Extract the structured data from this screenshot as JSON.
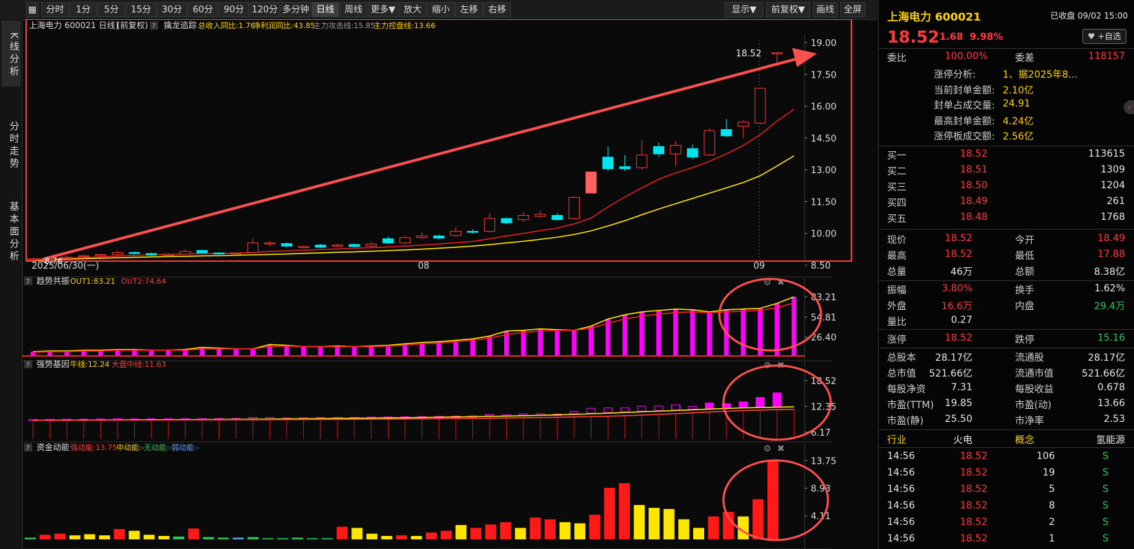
{
  "toolbar": {
    "left": [
      "分时",
      "1分",
      "5分",
      "15分",
      "30分",
      "60分",
      "90分",
      "120分",
      "多分钟",
      "日线",
      "周线",
      "更多▼",
      "放大",
      "缩小",
      "左移",
      "右移"
    ],
    "active": "日线",
    "right": [
      "显示▼",
      "前复权▼",
      "画线",
      "全屏"
    ]
  },
  "side_tabs": [
    "K线分析",
    "分时走势",
    "基本面分析"
  ],
  "kline": {
    "header": {
      "stock": "上海电力 600021 日线]",
      "adjust": "(前复权)",
      "q": "?",
      "indicator": "擒龙追踪",
      "items": [
        {
          "text": "总收入同比:1.76",
          "color": "#ffd400"
        },
        {
          "text": "净利润同比:43.85",
          "color": "#ffd400"
        },
        {
          "text": "主力攻击线:15.85",
          "color": "#9a9a9a"
        },
        {
          "text": "主力控盘线:13.66",
          "color": "#ffd400"
        }
      ]
    },
    "y_ticks": [
      "19.00",
      "17.50",
      "16.00",
      "14.50",
      "13.00",
      "11.50",
      "10.00",
      "8.50"
    ],
    "x_labels": [
      "2025/06/30(一)",
      "08",
      "09"
    ],
    "last_label": "18.52",
    "low_label": "8.76"
  },
  "ind1": {
    "title": "趋势共振",
    "q": "?",
    "items": [
      {
        "text": "OUT1:83.21",
        "color": "#ffd400"
      },
      {
        "text": "OUT2:74.64",
        "color": "#ff3a3a"
      }
    ],
    "y_ticks": [
      "83.21",
      "54.81",
      "26.40"
    ]
  },
  "ind2": {
    "title": "强势基因",
    "q": "?",
    "items": [
      {
        "text": "牛线:12.24",
        "color": "#ffd400"
      },
      {
        "text": "大盘中线:11.63",
        "color": "#ff3a3a"
      }
    ],
    "y_ticks": [
      "18.52",
      "12.35",
      "6.17"
    ]
  },
  "ind3": {
    "title": "资金动能",
    "q": "?",
    "items": [
      {
        "text": "强动能:13.75",
        "color": "#ff3a3a"
      },
      {
        "text": "中动能:-",
        "color": "#ffd400"
      },
      {
        "text": "无动能:-",
        "color": "#2ec55b"
      },
      {
        "text": "弱动能:-",
        "color": "#5aa0ff"
      }
    ],
    "y_ticks": [
      "13.75",
      "8.93",
      "4.11"
    ]
  },
  "chart_data": [
    {
      "type": "candlestick",
      "title": "上海电力 600021 日线",
      "ylim": [
        8.5,
        19.0
      ],
      "x_labels": [
        "2025/06/30(一)",
        "08",
        "09"
      ],
      "candles": [
        {
          "o": 8.76,
          "c": 8.8,
          "h": 8.85,
          "l": 8.7
        },
        {
          "o": 8.78,
          "c": 8.85,
          "h": 8.9,
          "l": 8.75
        },
        {
          "o": 8.85,
          "c": 8.88,
          "h": 8.95,
          "l": 8.8
        },
        {
          "o": 8.9,
          "c": 8.95,
          "h": 9.0,
          "l": 8.85
        },
        {
          "o": 8.95,
          "c": 9.0,
          "h": 9.05,
          "l": 8.9
        },
        {
          "o": 9.0,
          "c": 9.1,
          "h": 9.2,
          "l": 8.95
        },
        {
          "o": 9.1,
          "c": 9.05,
          "h": 9.15,
          "l": 9.0
        },
        {
          "o": 9.05,
          "c": 8.98,
          "h": 9.1,
          "l": 8.95
        },
        {
          "o": 9.0,
          "c": 9.02,
          "h": 9.06,
          "l": 8.96
        },
        {
          "o": 9.02,
          "c": 9.15,
          "h": 9.25,
          "l": 9.0
        },
        {
          "o": 9.2,
          "c": 9.08,
          "h": 9.22,
          "l": 9.05
        },
        {
          "o": 9.08,
          "c": 9.05,
          "h": 9.1,
          "l": 9.0
        },
        {
          "o": 9.05,
          "c": 9.08,
          "h": 9.12,
          "l": 9.02
        },
        {
          "o": 9.1,
          "c": 9.55,
          "h": 9.75,
          "l": 9.08
        },
        {
          "o": 9.5,
          "c": 9.55,
          "h": 9.65,
          "l": 9.4
        },
        {
          "o": 9.52,
          "c": 9.4,
          "h": 9.58,
          "l": 9.35
        },
        {
          "o": 9.35,
          "c": 9.38,
          "h": 9.42,
          "l": 9.3
        },
        {
          "o": 9.45,
          "c": 9.35,
          "h": 9.5,
          "l": 9.3
        },
        {
          "o": 9.4,
          "c": 9.45,
          "h": 9.5,
          "l": 9.35
        },
        {
          "o": 9.48,
          "c": 9.38,
          "h": 9.52,
          "l": 9.35
        },
        {
          "o": 9.4,
          "c": 9.5,
          "h": 9.58,
          "l": 9.36
        },
        {
          "o": 9.75,
          "c": 9.55,
          "h": 9.85,
          "l": 9.5
        },
        {
          "o": 9.55,
          "c": 9.8,
          "h": 9.9,
          "l": 9.5
        },
        {
          "o": 9.8,
          "c": 9.88,
          "h": 10.05,
          "l": 9.75
        },
        {
          "o": 9.88,
          "c": 9.78,
          "h": 9.95,
          "l": 9.72
        },
        {
          "o": 9.9,
          "c": 10.1,
          "h": 10.3,
          "l": 9.85
        },
        {
          "o": 10.1,
          "c": 10.05,
          "h": 10.2,
          "l": 9.98
        },
        {
          "o": 10.1,
          "c": 10.7,
          "h": 10.95,
          "l": 10.05
        },
        {
          "o": 10.7,
          "c": 10.5,
          "h": 10.75,
          "l": 10.45
        },
        {
          "o": 10.65,
          "c": 10.85,
          "h": 11.0,
          "l": 10.55
        },
        {
          "o": 10.8,
          "c": 10.9,
          "h": 11.05,
          "l": 10.75
        },
        {
          "o": 10.85,
          "c": 10.65,
          "h": 10.95,
          "l": 10.6
        },
        {
          "o": 10.7,
          "c": 11.7,
          "h": 11.75,
          "l": 10.65
        },
        {
          "o": 11.9,
          "c": 12.9,
          "h": 12.9,
          "l": 11.9
        },
        {
          "o": 13.6,
          "c": 13.05,
          "h": 14.1,
          "l": 12.95
        },
        {
          "o": 13.15,
          "c": 13.05,
          "h": 13.7,
          "l": 12.95
        },
        {
          "o": 13.1,
          "c": 13.7,
          "h": 14.4,
          "l": 13.0
        },
        {
          "o": 14.1,
          "c": 13.75,
          "h": 14.3,
          "l": 13.6
        },
        {
          "o": 13.75,
          "c": 14.15,
          "h": 14.35,
          "l": 13.2
        },
        {
          "o": 14.0,
          "c": 13.6,
          "h": 14.2,
          "l": 13.5
        },
        {
          "o": 13.7,
          "c": 14.85,
          "h": 14.95,
          "l": 13.65
        },
        {
          "o": 14.9,
          "c": 14.6,
          "h": 15.4,
          "l": 14.55
        },
        {
          "o": 15.05,
          "c": 15.25,
          "h": 15.35,
          "l": 14.5
        },
        {
          "o": 15.2,
          "c": 16.85,
          "h": 16.85,
          "l": 15.15
        },
        {
          "o": 18.49,
          "c": 18.52,
          "h": 18.52,
          "l": 17.88
        }
      ],
      "ma_red": [
        8.78,
        8.8,
        8.83,
        8.86,
        8.89,
        8.93,
        8.96,
        8.99,
        9.01,
        9.03,
        9.05,
        9.06,
        9.07,
        9.1,
        9.15,
        9.18,
        9.21,
        9.24,
        9.27,
        9.3,
        9.33,
        9.36,
        9.4,
        9.45,
        9.5,
        9.56,
        9.62,
        9.75,
        9.88,
        10.0,
        10.13,
        10.25,
        10.45,
        10.72,
        11.25,
        11.72,
        12.15,
        12.55,
        12.85,
        13.1,
        13.4,
        13.75,
        14.15,
        14.65,
        15.3,
        15.85
      ],
      "ma_yellow": [
        8.75,
        8.77,
        8.79,
        8.81,
        8.83,
        8.85,
        8.87,
        8.89,
        8.91,
        8.92,
        8.94,
        8.95,
        8.97,
        8.99,
        9.01,
        9.03,
        9.06,
        9.08,
        9.11,
        9.13,
        9.16,
        9.19,
        9.22,
        9.26,
        9.3,
        9.35,
        9.4,
        9.47,
        9.55,
        9.63,
        9.72,
        9.82,
        9.95,
        10.12,
        10.35,
        10.6,
        10.88,
        11.15,
        11.4,
        11.65,
        11.9,
        12.15,
        12.4,
        12.72,
        13.18,
        13.66
      ]
    },
    {
      "type": "bar",
      "title": "趋势共振",
      "ylim": [
        0,
        90
      ],
      "series": [
        {
          "name": "OUT1",
          "values": [
            6,
            7,
            7,
            8,
            8,
            9,
            9,
            8,
            8,
            9,
            12,
            11,
            10,
            10,
            16,
            15,
            13,
            13,
            14,
            13,
            14,
            15,
            17,
            19,
            20,
            22,
            24,
            28,
            35,
            36,
            38,
            37,
            36,
            42,
            52,
            58,
            62,
            64,
            66,
            65,
            62,
            65,
            66,
            67,
            74,
            83.21
          ]
        },
        {
          "name": "OUT2",
          "values": [
            5,
            6,
            6,
            7,
            7,
            8,
            8,
            8,
            8,
            8,
            10,
            10,
            10,
            10,
            13,
            14,
            13,
            13,
            13,
            13,
            13,
            14,
            15,
            17,
            18,
            20,
            22,
            25,
            30,
            33,
            35,
            36,
            36,
            39,
            46,
            52,
            56,
            59,
            61,
            62,
            61,
            62,
            63,
            64,
            68,
            74.64
          ]
        }
      ]
    },
    {
      "type": "bar",
      "title": "强势基因",
      "ylim": [
        4.5,
        20
      ],
      "series": [
        {
          "name": "牛线",
          "values": [
            9.0,
            9.02,
            9.04,
            9.06,
            9.08,
            9.1,
            9.12,
            9.14,
            9.16,
            9.18,
            9.2,
            9.22,
            9.24,
            9.26,
            9.3,
            9.34,
            9.38,
            9.42,
            9.46,
            9.5,
            9.54,
            9.58,
            9.62,
            9.68,
            9.74,
            9.8,
            9.86,
            9.94,
            10.02,
            10.1,
            10.2,
            10.3,
            10.42,
            10.56,
            10.72,
            10.88,
            11.04,
            11.2,
            11.36,
            11.52,
            11.68,
            11.84,
            11.98,
            12.08,
            12.16,
            12.24
          ]
        },
        {
          "name": "大盘中线",
          "values": [
            9.0,
            9.01,
            9.02,
            9.03,
            9.04,
            9.05,
            9.06,
            9.07,
            9.08,
            9.09,
            9.1,
            9.11,
            9.12,
            9.13,
            9.15,
            9.17,
            9.19,
            9.21,
            9.23,
            9.25,
            9.27,
            9.29,
            9.32,
            9.35,
            9.38,
            9.42,
            9.46,
            9.5,
            9.55,
            9.6,
            9.66,
            9.72,
            9.8,
            9.88,
            9.98,
            10.1,
            10.25,
            10.42,
            10.6,
            10.8,
            11.0,
            11.18,
            11.34,
            11.46,
            11.56,
            11.63
          ]
        }
      ]
    },
    {
      "type": "bar",
      "title": "资金动能",
      "ylim": [
        0,
        14.5
      ],
      "values": [
        0.3,
        0.8,
        1.0,
        0.7,
        0.9,
        0.7,
        1.8,
        1.5,
        0.8,
        0.6,
        0.5,
        1.9,
        0.4,
        0.3,
        0.3,
        0.4,
        0.2,
        0.2,
        0.3,
        0.2,
        0.2,
        2.2,
        2.0,
        1.0,
        0.6,
        0.7,
        0.6,
        1.2,
        1.5,
        2.5,
        2.0,
        2.6,
        3.0,
        2.0,
        3.8,
        3.5,
        3.0,
        2.8,
        4.3,
        9.0,
        9.8,
        6.0,
        5.5,
        5.3,
        3.5,
        2.0,
        4.0,
        4.8,
        4.0,
        7.0,
        13.75
      ],
      "colors": [
        "#2ec55b",
        "#ff1a1a",
        "#ff1a1a",
        "#ffe600",
        "#ffe600",
        "#ffe600",
        "#ff1a1a",
        "#ffe600",
        "#ffe600",
        "#ffe600",
        "#2ec55b",
        "#ff1a1a",
        "#2ec55b",
        "#2ec55b",
        "#5aa0ff",
        "#2ec55b",
        "#2ec55b",
        "#2ec55b",
        "#2ec55b",
        "#2ec55b",
        "#2ec55b",
        "#ff1a1a",
        "#ffe600",
        "#ffe600",
        "#ffe600",
        "#ff1a1a",
        "#ffe600",
        "#ff1a1a",
        "#ff1a1a",
        "#ffe600",
        "#ff1a1a",
        "#ff1a1a",
        "#ff1a1a",
        "#ffe600",
        "#ff1a1a",
        "#ff1a1a",
        "#ffe600",
        "#ffe600",
        "#ff1a1a",
        "#ff1a1a",
        "#ff1a1a",
        "#ffe600",
        "#ffe600",
        "#ffe600",
        "#ffe600",
        "#ffe600",
        "#ff1a1a",
        "#ff1a1a",
        "#ffe600",
        "#ff1a1a",
        "#ff1a1a"
      ]
    }
  ],
  "panel": {
    "name": "上海电力 600021",
    "status": "已收盘 09/02 15:00",
    "price": "18.52",
    "change": "1.68",
    "pct": "9.98%",
    "watch": "+自选",
    "row1": {
      "l1": "委比",
      "v1": "100.00%",
      "l2": "委差",
      "v2": "118157"
    },
    "limit": [
      {
        "k": "涨停分析:",
        "v": "1、据2025年8..."
      },
      {
        "k": "当前封单金额:",
        "v": "2.10亿"
      },
      {
        "k": "封单占成交量:",
        "v": "24.91"
      },
      {
        "k": "最高封单金额:",
        "v": "4.24亿"
      },
      {
        "k": "涨停板成交额:",
        "v": "2.56亿"
      }
    ],
    "bids": [
      {
        "l": "买一",
        "p": "18.52",
        "v": "113615"
      },
      {
        "l": "买二",
        "p": "18.51",
        "v": "1309"
      },
      {
        "l": "买三",
        "p": "18.50",
        "v": "1204"
      },
      {
        "l": "买四",
        "p": "18.49",
        "v": "261"
      },
      {
        "l": "买五",
        "p": "18.48",
        "v": "1768"
      }
    ],
    "quote1": [
      {
        "l1": "现价",
        "v1": "18.52",
        "c1": "red",
        "l2": "今开",
        "v2": "18.49",
        "c2": "red"
      },
      {
        "l1": "最高",
        "v1": "18.52",
        "c1": "red",
        "l2": "最低",
        "v2": "17.88",
        "c2": "red"
      },
      {
        "l1": "总量",
        "v1": "46万",
        "c1": "white",
        "l2": "总额",
        "v2": "8.38亿",
        "c2": "white"
      }
    ],
    "quote2": [
      {
        "l1": "振幅",
        "v1": "3.80%",
        "c1": "red",
        "l2": "换手",
        "v2": "1.62%",
        "c2": "white"
      },
      {
        "l1": "外盘",
        "v1": "16.6万",
        "c1": "red",
        "l2": "内盘",
        "v2": "29.4万",
        "c2": "green"
      },
      {
        "l1": "量比",
        "v1": "0.27",
        "c1": "white",
        "l2": "",
        "v2": "",
        "c2": "white"
      }
    ],
    "limits": {
      "l1": "涨停",
      "v1": "18.52",
      "l2": "跌停",
      "v2": "15.16"
    },
    "fund": [
      {
        "l1": "总股本",
        "v1": "28.17亿",
        "l2": "流通股",
        "v2": "28.17亿"
      },
      {
        "l1": "总市值",
        "v1": "521.66亿",
        "l2": "流通市值",
        "v2": "521.66亿"
      },
      {
        "l1": "每股净资",
        "v1": "7.31",
        "l2": "每股收益",
        "v2": "0.678"
      },
      {
        "l1": "市盈(TTM)",
        "v1": "19.85",
        "l2": "市盈(动)",
        "v2": "13.66"
      },
      {
        "l1": "市盈(静)",
        "v1": "25.50",
        "l2": "市净率",
        "v2": "2.53"
      }
    ],
    "industry": {
      "l1": "行业",
      "v1": "火电",
      "l2": "概念",
      "v2": "氢能源"
    },
    "trades": [
      {
        "t": "14:56",
        "p": "18.52",
        "v": "106",
        "s": "S"
      },
      {
        "t": "14:56",
        "p": "18.52",
        "v": "19",
        "s": "S"
      },
      {
        "t": "14:56",
        "p": "18.52",
        "v": "5",
        "s": "S"
      },
      {
        "t": "14:56",
        "p": "18.52",
        "v": "8",
        "s": "S"
      },
      {
        "t": "14:56",
        "p": "18.52",
        "v": "2",
        "s": "S"
      },
      {
        "t": "14:56",
        "p": "18.52",
        "v": "1",
        "s": "S"
      }
    ]
  }
}
